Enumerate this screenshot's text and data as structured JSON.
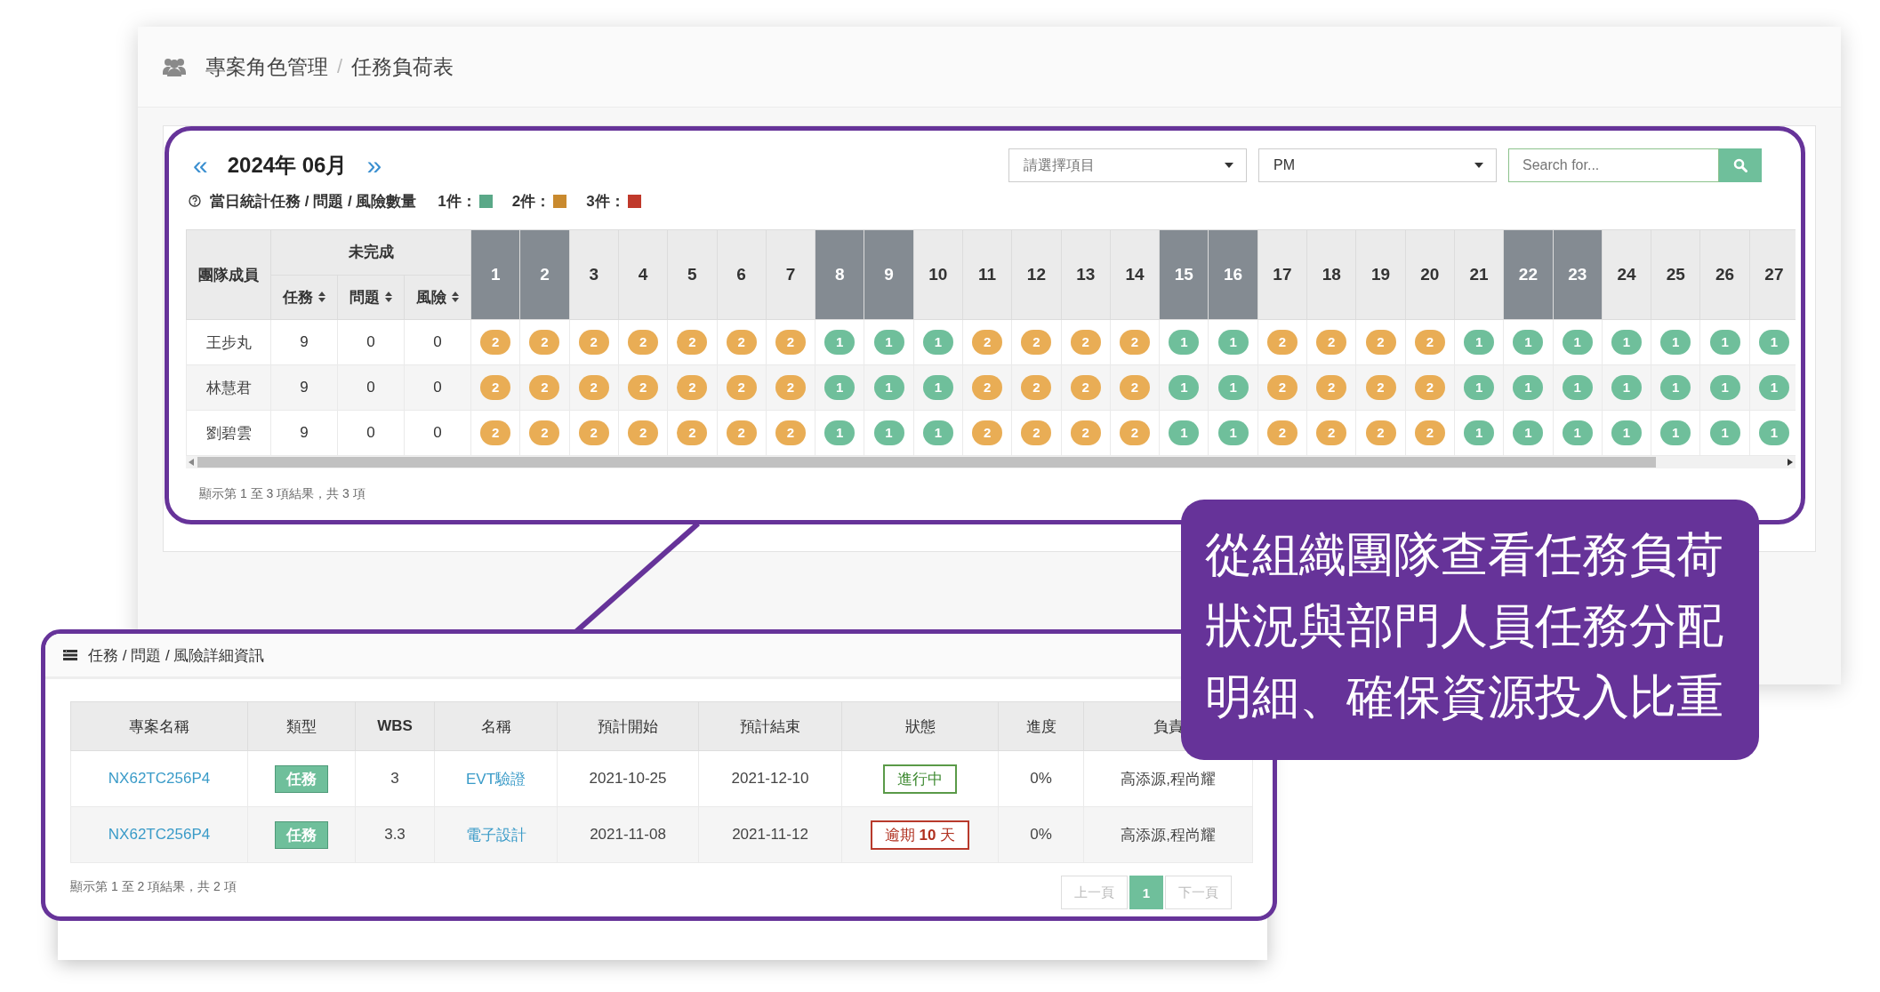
{
  "breadcrumb": {
    "items": [
      "專案角色管理",
      "任務負荷表"
    ],
    "separator": "/"
  },
  "calendar": {
    "prev": "«",
    "title": "2024年 06月",
    "next": "»",
    "filters": [
      {
        "kind": "select",
        "placeholder": "請選擇項目"
      },
      {
        "kind": "select",
        "value": "PM"
      }
    ],
    "search": {
      "placeholder": "Search for..."
    },
    "legend": {
      "text": "當日統計任務 / 問題 / 風險數量",
      "items": [
        {
          "label": "1件：",
          "color": "#5aa888"
        },
        {
          "label": "2件：",
          "color": "#c98a2e"
        },
        {
          "label": "3件：",
          "color": "#c0392b"
        }
      ]
    },
    "table": {
      "member_header": "團隊成員",
      "group_header": "未完成",
      "sort_columns": [
        "任務",
        "問題",
        "風險"
      ],
      "days": [
        {
          "label": "1",
          "weekend": true
        },
        {
          "label": "2",
          "weekend": true
        },
        {
          "label": "3",
          "weekend": false
        },
        {
          "label": "4",
          "weekend": false
        },
        {
          "label": "5",
          "weekend": false
        },
        {
          "label": "6",
          "weekend": false
        },
        {
          "label": "7",
          "weekend": false
        },
        {
          "label": "8",
          "weekend": true
        },
        {
          "label": "9",
          "weekend": true
        },
        {
          "label": "10",
          "weekend": false
        },
        {
          "label": "11",
          "weekend": false
        },
        {
          "label": "12",
          "weekend": false
        },
        {
          "label": "13",
          "weekend": false
        },
        {
          "label": "14",
          "weekend": false
        },
        {
          "label": "15",
          "weekend": true
        },
        {
          "label": "16",
          "weekend": true
        },
        {
          "label": "17",
          "weekend": false
        },
        {
          "label": "18",
          "weekend": false
        },
        {
          "label": "19",
          "weekend": false
        },
        {
          "label": "20",
          "weekend": false
        },
        {
          "label": "21",
          "weekend": false
        },
        {
          "label": "22",
          "weekend": true
        },
        {
          "label": "23",
          "weekend": true
        },
        {
          "label": "24",
          "weekend": false
        },
        {
          "label": "25",
          "weekend": false
        },
        {
          "label": "26",
          "weekend": false
        },
        {
          "label": "27",
          "weekend": false
        }
      ],
      "rows": [
        {
          "member": "王步丸",
          "counts": [
            "9",
            "0",
            "0"
          ],
          "daily": [
            "2",
            "2",
            "2",
            "2",
            "2",
            "2",
            "2",
            "1",
            "1",
            "1",
            "2",
            "2",
            "2",
            "2",
            "1",
            "1",
            "2",
            "2",
            "2",
            "2",
            "1",
            "1",
            "1",
            "1",
            "1",
            "1",
            "1"
          ]
        },
        {
          "member": "林慧君",
          "counts": [
            "9",
            "0",
            "0"
          ],
          "daily": [
            "2",
            "2",
            "2",
            "2",
            "2",
            "2",
            "2",
            "1",
            "1",
            "1",
            "2",
            "2",
            "2",
            "2",
            "1",
            "1",
            "2",
            "2",
            "2",
            "2",
            "1",
            "1",
            "1",
            "1",
            "1",
            "1",
            "1"
          ]
        },
        {
          "member": "劉碧雲",
          "counts": [
            "9",
            "0",
            "0"
          ],
          "daily": [
            "2",
            "2",
            "2",
            "2",
            "2",
            "2",
            "2",
            "1",
            "1",
            "1",
            "2",
            "2",
            "2",
            "2",
            "1",
            "1",
            "2",
            "2",
            "2",
            "2",
            "1",
            "1",
            "1",
            "1",
            "1",
            "1",
            "1"
          ]
        }
      ]
    },
    "footer": "顯示第 1 至 3 項結果，共 3 項"
  },
  "details": {
    "title": "任務 / 問題 / 風險詳細資訊",
    "columns": [
      "專案名稱",
      "類型",
      "WBS",
      "名稱",
      "預計開始",
      "預計結束",
      "狀態",
      "進度",
      "負責"
    ],
    "rows": [
      {
        "project": "NX62TC256P4",
        "type": "任務",
        "wbs": "3",
        "name": "EVT驗證",
        "start": "2021-10-25",
        "end": "2021-12-10",
        "status": {
          "kind": "in_progress",
          "text": "進行中"
        },
        "progress": "0%",
        "owner": "高添源,程尚耀"
      },
      {
        "project": "NX62TC256P4",
        "type": "任務",
        "wbs": "3.3",
        "name": "電子設計",
        "start": "2021-11-08",
        "end": "2021-11-12",
        "status": {
          "kind": "overdue",
          "text": "逾期 **10** 天"
        },
        "progress": "0%",
        "owner": "高添源,程尚耀"
      }
    ],
    "footer": "顯示第 1 至 2 項結果，共 2 項",
    "pagination": [
      {
        "label": "上一頁",
        "selected": false,
        "disabled": true
      },
      {
        "label": "1",
        "selected": true,
        "disabled": false
      },
      {
        "label": "下一頁",
        "selected": false,
        "disabled": true
      }
    ]
  },
  "callout": {
    "text": "從組織團隊查看任務負荷狀況與部門人員任務分配明細、確保資源投入比重"
  }
}
